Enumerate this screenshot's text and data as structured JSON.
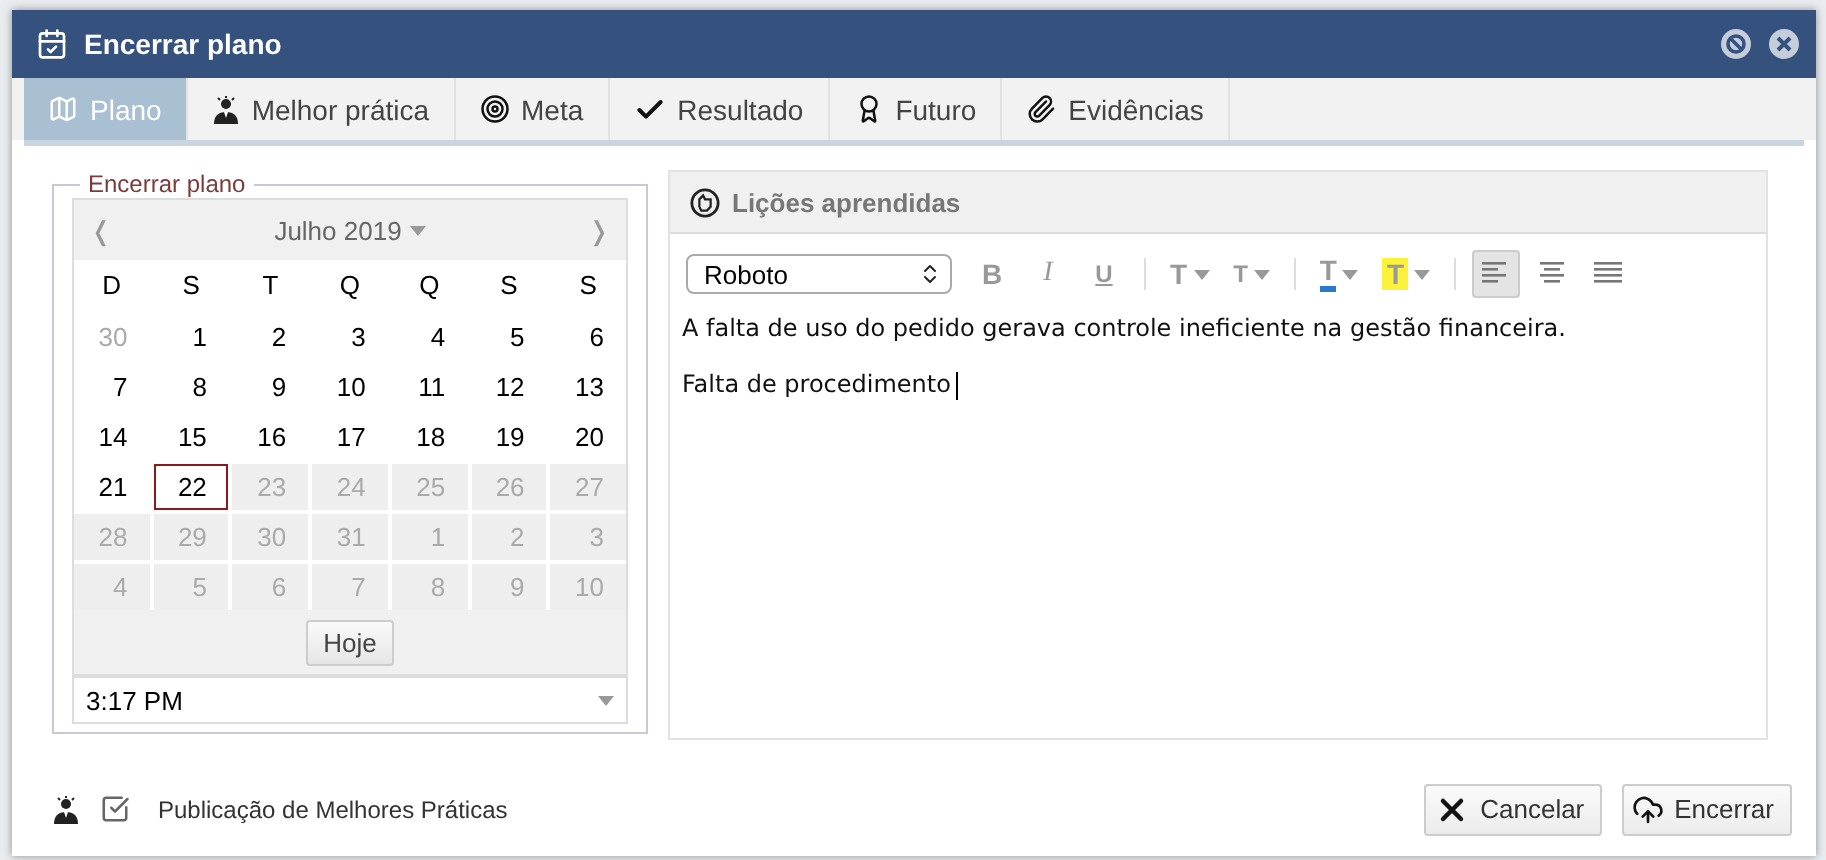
{
  "window": {
    "title": "Encerrar plano"
  },
  "tabs": [
    {
      "label": "Plano",
      "kind": "map",
      "selected": true
    },
    {
      "label": "Melhor prática",
      "kind": "person",
      "selected": false
    },
    {
      "label": "Meta",
      "kind": "target",
      "selected": false
    },
    {
      "label": "Resultado",
      "kind": "check",
      "selected": false
    },
    {
      "label": "Futuro",
      "kind": "award",
      "selected": false
    },
    {
      "label": "Evidências",
      "kind": "clip",
      "selected": false
    }
  ],
  "date_panel": {
    "legend": "Encerrar plano",
    "prev": "❬",
    "next": "❭",
    "month": "Julho 2019",
    "weekdays": [
      "D",
      "S",
      "T",
      "Q",
      "Q",
      "S",
      "S"
    ],
    "weeks": [
      [
        {
          "d": "30",
          "kind": "outside",
          "selected": false
        },
        {
          "d": "1",
          "kind": "normal",
          "selected": false
        },
        {
          "d": "2",
          "kind": "normal",
          "selected": false
        },
        {
          "d": "3",
          "kind": "normal",
          "selected": false
        },
        {
          "d": "4",
          "kind": "normal",
          "selected": false
        },
        {
          "d": "5",
          "kind": "normal",
          "selected": false
        },
        {
          "d": "6",
          "kind": "normal",
          "selected": false
        }
      ],
      [
        {
          "d": "7",
          "kind": "normal",
          "selected": false
        },
        {
          "d": "8",
          "kind": "normal",
          "selected": false
        },
        {
          "d": "9",
          "kind": "normal",
          "selected": false
        },
        {
          "d": "10",
          "kind": "normal",
          "selected": false
        },
        {
          "d": "11",
          "kind": "normal",
          "selected": false
        },
        {
          "d": "12",
          "kind": "normal",
          "selected": false
        },
        {
          "d": "13",
          "kind": "normal",
          "selected": false
        }
      ],
      [
        {
          "d": "14",
          "kind": "normal",
          "selected": false
        },
        {
          "d": "15",
          "kind": "normal",
          "selected": false
        },
        {
          "d": "16",
          "kind": "normal",
          "selected": false
        },
        {
          "d": "17",
          "kind": "normal",
          "selected": false
        },
        {
          "d": "18",
          "kind": "normal",
          "selected": false
        },
        {
          "d": "19",
          "kind": "normal",
          "selected": false
        },
        {
          "d": "20",
          "kind": "normal",
          "selected": false
        }
      ],
      [
        {
          "d": "21",
          "kind": "normal",
          "selected": false
        },
        {
          "d": "22",
          "kind": "normal",
          "selected": true
        },
        {
          "d": "23",
          "kind": "disabled",
          "selected": false
        },
        {
          "d": "24",
          "kind": "disabled",
          "selected": false
        },
        {
          "d": "25",
          "kind": "disabled",
          "selected": false
        },
        {
          "d": "26",
          "kind": "disabled",
          "selected": false
        },
        {
          "d": "27",
          "kind": "disabled",
          "selected": false
        }
      ],
      [
        {
          "d": "28",
          "kind": "disabled",
          "selected": false
        },
        {
          "d": "29",
          "kind": "disabled",
          "selected": false
        },
        {
          "d": "30",
          "kind": "disabled",
          "selected": false
        },
        {
          "d": "31",
          "kind": "disabled",
          "selected": false
        },
        {
          "d": "1",
          "kind": "disabled",
          "selected": false
        },
        {
          "d": "2",
          "kind": "disabled",
          "selected": false
        },
        {
          "d": "3",
          "kind": "disabled",
          "selected": false
        }
      ],
      [
        {
          "d": "4",
          "kind": "disabled",
          "selected": false
        },
        {
          "d": "5",
          "kind": "disabled",
          "selected": false
        },
        {
          "d": "6",
          "kind": "disabled",
          "selected": false
        },
        {
          "d": "7",
          "kind": "disabled",
          "selected": false
        },
        {
          "d": "8",
          "kind": "disabled",
          "selected": false
        },
        {
          "d": "9",
          "kind": "disabled",
          "selected": false
        },
        {
          "d": "10",
          "kind": "disabled",
          "selected": false
        }
      ]
    ],
    "today_button": "Hoje",
    "time": "3:17 PM"
  },
  "lessons": {
    "title": "Lições aprendidas",
    "font": "Roboto",
    "toolbar": [
      {
        "kind": "bold",
        "label": "B"
      },
      {
        "kind": "italic",
        "label": "I"
      },
      {
        "kind": "underline",
        "label": "U"
      },
      {
        "kind": "sep"
      },
      {
        "kind": "grow",
        "label": "T"
      },
      {
        "kind": "shrink",
        "label": "T"
      },
      {
        "kind": "sep"
      },
      {
        "kind": "color",
        "label": "T"
      },
      {
        "kind": "highlight",
        "label": "T"
      },
      {
        "kind": "sep"
      },
      {
        "kind": "align-left",
        "selected": true
      },
      {
        "kind": "align-center",
        "selected": false
      },
      {
        "kind": "align-justify",
        "selected": false
      }
    ],
    "paragraphs": [
      "A falta de uso do pedido gerava controle ineficiente na gestão financeira.",
      "Falta de procedimento"
    ]
  },
  "footer": {
    "publish_checked": true,
    "publish_label": "Publicação de Melhores Práticas",
    "buttons": [
      {
        "label": "Cancelar",
        "kind": "cancel"
      },
      {
        "label": "Encerrar",
        "kind": "submit"
      }
    ]
  }
}
